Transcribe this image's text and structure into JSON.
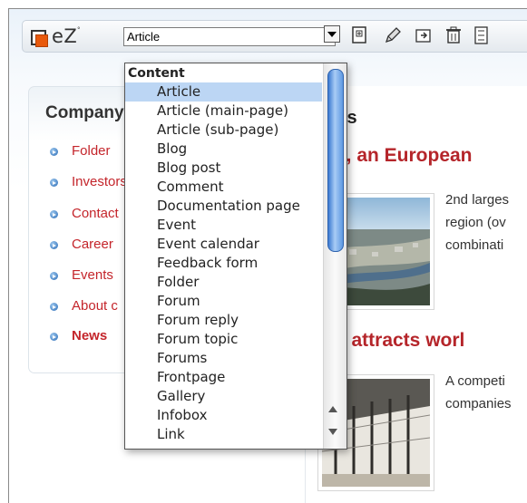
{
  "toolbar": {
    "logo_text": "eZ",
    "logo_mark": "°",
    "class_select_value": "Article",
    "icons": [
      "new-document-icon",
      "edit-pencil-icon",
      "move-icon",
      "trash-icon",
      "sort-icon"
    ]
  },
  "left_menu": {
    "title": "Company",
    "items": [
      {
        "label": "Folder"
      },
      {
        "label": "Investors Re"
      },
      {
        "label": "Contact"
      },
      {
        "label": "Career"
      },
      {
        "label": "Events"
      },
      {
        "label": "About c"
      },
      {
        "label": "News",
        "active": true
      }
    ]
  },
  "main": {
    "title": "ws",
    "headline1": "on, an European",
    "paragraph1": [
      "2nd larges",
      "region (ov",
      "combinati"
    ],
    "headline2": "on attracts worl",
    "paragraph2": [
      "A competi",
      "companies"
    ]
  },
  "dropdown": {
    "group_label": "Content",
    "selected": "Article",
    "options": [
      "Article",
      "Article (main-page)",
      "Article (sub-page)",
      "Blog",
      "Blog post",
      "Comment",
      "Documentation page",
      "Event",
      "Event calendar",
      "Feedback form",
      "Folder",
      "Forum",
      "Forum reply",
      "Forum topic",
      "Forums",
      "Frontpage",
      "Gallery",
      "Infobox",
      "Link"
    ]
  },
  "colors": {
    "link": "#c4252b",
    "headline": "#b5252a",
    "selection": "#bcd6f4",
    "logo_orange": "#e8590c"
  }
}
